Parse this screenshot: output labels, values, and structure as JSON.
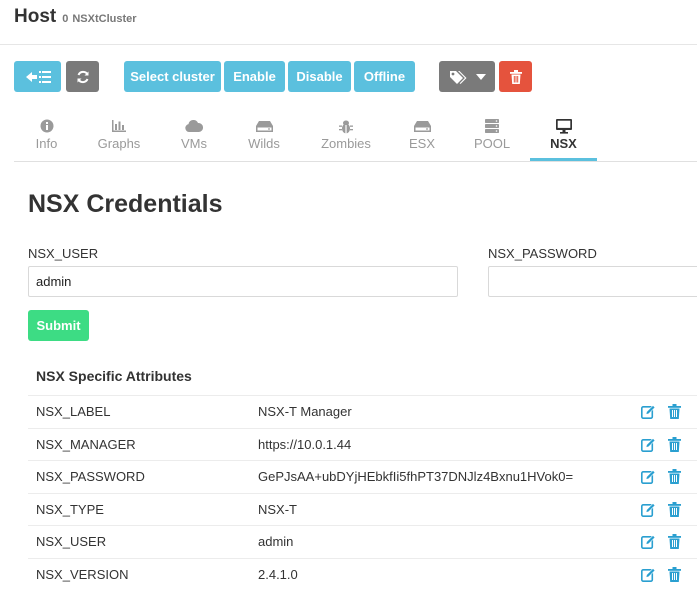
{
  "header": {
    "title": "Host",
    "count": "0",
    "cluster": "NSXtCluster"
  },
  "toolbar": {
    "select_cluster": "Select cluster",
    "enable": "Enable",
    "disable": "Disable",
    "offline": "Offline"
  },
  "tabs": [
    {
      "label": "Info",
      "icon": "info-icon"
    },
    {
      "label": "Graphs",
      "icon": "bar-chart-icon"
    },
    {
      "label": "VMs",
      "icon": "cloud-icon"
    },
    {
      "label": "Wilds",
      "icon": "hdd-icon"
    },
    {
      "label": "Zombies",
      "icon": "bug-icon"
    },
    {
      "label": "ESX",
      "icon": "hdd-icon"
    },
    {
      "label": "POOL",
      "icon": "server-icon"
    },
    {
      "label": "NSX",
      "icon": "desktop-icon"
    }
  ],
  "active_tab": "NSX",
  "credentials": {
    "heading": "NSX Credentials",
    "user_label": "NSX_USER",
    "user_value": "admin",
    "password_label": "NSX_PASSWORD",
    "password_value": "",
    "submit": "Submit"
  },
  "attributes": {
    "title": "NSX Specific Attributes",
    "rows": [
      {
        "key": "NSX_LABEL",
        "value": "NSX-T Manager"
      },
      {
        "key": "NSX_MANAGER",
        "value": "https://10.0.1.44"
      },
      {
        "key": "NSX_PASSWORD",
        "value": "GePJsAA+ubDYjHEbkfIi5fhPT37DNJlz4Bxnu1HVok0="
      },
      {
        "key": "NSX_TYPE",
        "value": "NSX-T"
      },
      {
        "key": "NSX_USER",
        "value": "admin"
      },
      {
        "key": "NSX_VERSION",
        "value": "2.4.1.0"
      }
    ]
  },
  "colors": {
    "info": "#5bc0de",
    "gray": "#7a7a7a",
    "danger": "#e5533d",
    "success": "#3ddc84",
    "icon_action": "#2a9fd0"
  }
}
